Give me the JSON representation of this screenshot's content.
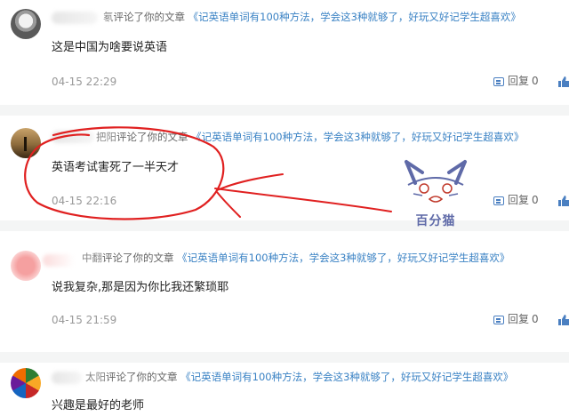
{
  "comments": [
    {
      "username": "氡",
      "action": "评论了你的文章",
      "article": "《记英语单词有100种方法，学会这3种就够了，好玩又好记学生超喜欢》",
      "text": "这是中国为啥要说英语",
      "time": "04-15 22:29",
      "reply_label": "回复",
      "reply_count": "0",
      "avatar": "grey-person-photo"
    },
    {
      "username": "把阳",
      "action": "评论了你的文章",
      "article": "《记英语单词有100种方法，学会这3种就够了，好玩又好记学生超喜欢》",
      "text": "英语考试害死了一半天才",
      "time": "04-15 22:16",
      "reply_label": "回复",
      "reply_count": "0",
      "avatar": "sunset-silhouette-photo"
    },
    {
      "username": "中翻",
      "action": "评论了你的文章",
      "article": "《记英语单词有100种方法，学会这3种就够了，好玩又好记学生超喜欢》",
      "text": "说我复杂,那是因为你比我还繁琐耶",
      "time": "04-15 21:59",
      "reply_label": "回复",
      "reply_count": "0",
      "avatar": "pink-blurred"
    },
    {
      "username": "太阳",
      "action": "评论了你的文章",
      "article": "《记英语单词有100种方法，学会这3种就够了，好玩又好记学生超喜欢》",
      "text": "兴趣是最好的老师",
      "time": "",
      "reply_label": "",
      "reply_count": "",
      "avatar": "colored-pencils"
    }
  ],
  "watermark": {
    "text": "百分猫",
    "color": "#5f6aa8"
  },
  "annotation_color": "#e02020",
  "colors": {
    "link": "#3a82c4",
    "separator": "#f4f5f5",
    "icon": "#4a7fc1"
  }
}
